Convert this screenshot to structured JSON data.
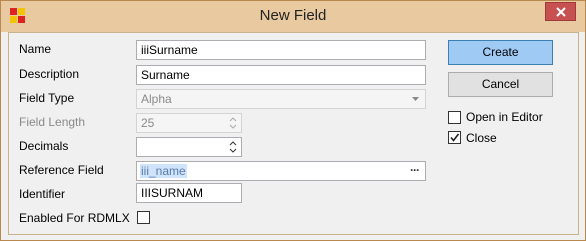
{
  "window": {
    "title": "New Field"
  },
  "form": {
    "name_label": "Name",
    "name_value": "iiiSurname",
    "description_label": "Description",
    "description_value": "Surname",
    "field_type_label": "Field Type",
    "field_type_value": "Alpha",
    "field_length_label": "Field Length",
    "field_length_value": "25",
    "decimals_label": "Decimals",
    "decimals_value": "",
    "reference_field_label": "Reference Field",
    "reference_field_value": "iii_name",
    "reference_field_button": "···",
    "identifier_label": "Identifier",
    "identifier_value": "IIISURNAM",
    "enabled_rdmlx_label": "Enabled For RDMLX",
    "enabled_rdmlx_checked": false
  },
  "actions": {
    "create_label": "Create",
    "cancel_label": "Cancel"
  },
  "options": {
    "open_in_editor_label": "Open in Editor",
    "open_in_editor_checked": false,
    "close_label": "Close",
    "close_checked": true
  },
  "colors": {
    "titlebar": "#e8c9a0",
    "close_button": "#c75050",
    "primary_button": "#9fcaf4"
  }
}
